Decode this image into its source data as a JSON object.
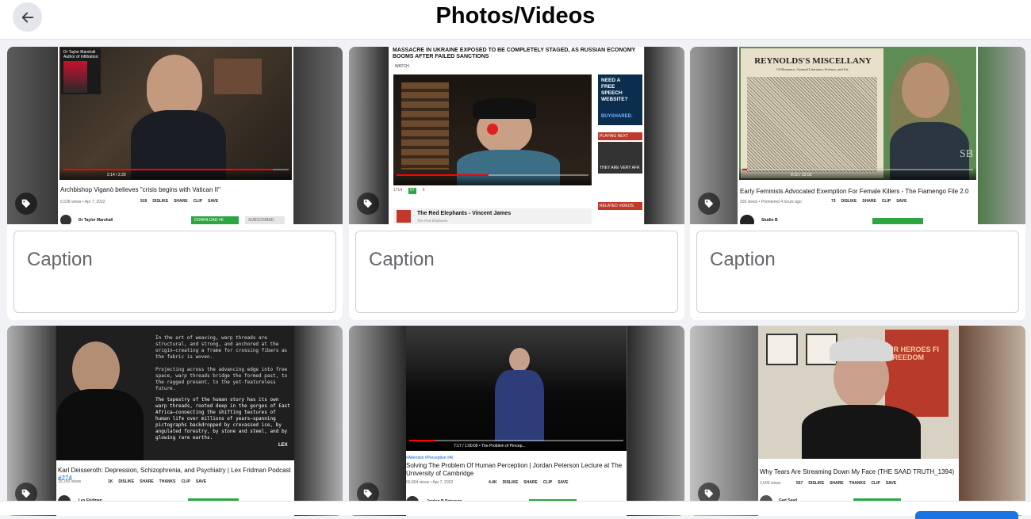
{
  "header": {
    "title": "Photos/Videos"
  },
  "caption_placeholder": "Caption",
  "items": [
    {
      "video_title": "Archbishop Viganò believes \"crisis begins with Vatican II\"",
      "meta": "6,538 views • Apr 7, 2022",
      "likes": "919",
      "actions": [
        "DISLIKE",
        "SHARE",
        "CLIP",
        "SAVE"
      ],
      "time": "2:14 / 2:29",
      "channel": "Dr Taylor Marshall",
      "overlay": "Dr Taylor Marshall\nAuthor of Infiltration:",
      "button": "DOWNLOAD 4K",
      "subscribe": "SUBSCRIBED"
    },
    {
      "headline": "MASSACRE IN UKRAINE EXPOSED TO BE COMPLETELY STAGED, AS RUSSIAN ECONOMY BOOMS AFTER FAILED SANCTIONS",
      "watch": "WATCH",
      "ad_text": "NEED A FREE SPEECH WEBSITE?",
      "ad_brand": "BUYSHARED.",
      "playing_next": "PLAYING NEXT",
      "side_caption": "THEY ARE VERY AFR",
      "related": "RELATED VIDEOS",
      "channel_title": "The Red Elephants - Vincent James",
      "channel_sub": "The Red Elephants",
      "views_bar": "1714",
      "likes_bar": "67",
      "dislikes_bar": "6"
    },
    {
      "video_title": "Early Feminists Advocated Exemption For Female Killers - The Fiamengo File 2.0",
      "meta": "203 views • Premiered 4 hours ago",
      "likes": "73",
      "actions": [
        "DISLIKE",
        "SHARE",
        "CLIP",
        "SAVE"
      ],
      "time": "0:10 / 22:02",
      "channel": "Studio B",
      "newspaper": "REYNOLDS'S MISCELLANY",
      "newspaper_sub": "Of Romance, General Literature, Science, and Art.",
      "watermark": "SB"
    },
    {
      "video_title": "Karl Deisseroth: Depression, Schizophrenia, and Psychiatry | Lex Fridman Podcast",
      "episode": "#274",
      "meta": "15,150 views",
      "likes": "1K",
      "actions": [
        "DISLIKE",
        "SHARE",
        "THANKS",
        "CLIP",
        "SAVE"
      ],
      "channel": "Lex Fridman",
      "overlay_p1": "In the art of weaving, warp threads are structural, and strong, and anchored at the origin—creating a frame for crossing fibers as the fabric is woven.",
      "overlay_p2": "Projecting across the advancing edge into free space, warp threads bridge the formed past, to the ragged present, to the yet-featureless future.",
      "overlay_p3": "The tapestry of the human story has its own warp threads, rooted deep in the gorges of East Africa—connecting the shifting textures of human life over millions of years—spanning pictographs backdropped by crevassed ice, by angulated forestry, by stone and steel, and by glowing rare earths.",
      "brand": "LEX"
    },
    {
      "hashtags": "#Attention #Perception #AI",
      "video_title": "Solving The Problem Of Human Perception | Jordan Peterson Lecture at The University of Cambridge",
      "meta": "56,804 views • Apr 7, 2022",
      "likes": "4.4K",
      "actions": [
        "DISLIKE",
        "SHARE",
        "CLIP",
        "SAVE"
      ],
      "time": "7:17 / 1:00:09 • The Problem of Percep...",
      "channel": "Jordan B Peterson"
    },
    {
      "video_title": "Why Tears Are Streaming Down My Face (THE SAAD TRUTH_1394)",
      "meta": "2,605 views",
      "likes": "557",
      "actions": [
        "DISLIKE",
        "SHARE",
        "THANKS",
        "CLIP",
        "SAVE"
      ],
      "channel": "Gad Saad",
      "poster": "UR HEROES FI\nFREEDOM"
    }
  ],
  "colors": {
    "accent": "#1b74e4",
    "yt_red": "#ff0000",
    "yt_green": "#2ba640"
  }
}
